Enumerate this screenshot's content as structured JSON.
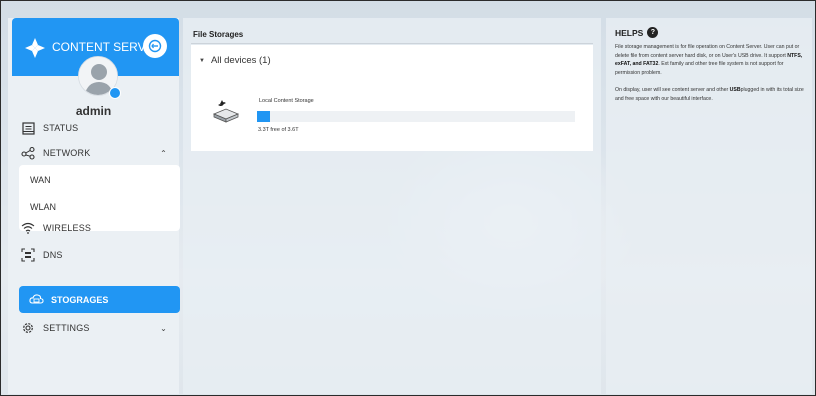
{
  "sidebar": {
    "brand": "CONTENT SERVER",
    "user": "admin",
    "items": {
      "status": "STATUS",
      "network": "NETWORK",
      "wan": "WAN",
      "wlan": "WLAN",
      "wireless": "WIRELESS",
      "dns": "DNS",
      "storages": "STOGRAGES",
      "settings": "SETTINGS"
    },
    "icons": {
      "network_chevron": "chevron-up-icon",
      "settings_chevron": "chevron-down-icon"
    }
  },
  "main": {
    "title": "File Storages",
    "devices_label": "All devices (1)",
    "storage": {
      "name": "Local Content Storage",
      "free_text": "3.3T free of 3.6T",
      "used_fraction": 0.04
    }
  },
  "help": {
    "title": "HELPS",
    "p1_a": "File storage management is for file operation on Content Server. User can put or delete file from content server hard disk, or on User's USB drive. It support ",
    "p1_b": "NTFS, exFAT, and FAT32",
    "p1_c": ". Ext family and other tree file system is not support for permission problem.",
    "p2_a": "On display, user will see content server and other ",
    "p2_b": "USB",
    "p2_c": "plugged in with its total size and free space with our beautiful interface."
  },
  "colors": {
    "accent": "#2196f3",
    "background": "#dde5ec"
  }
}
